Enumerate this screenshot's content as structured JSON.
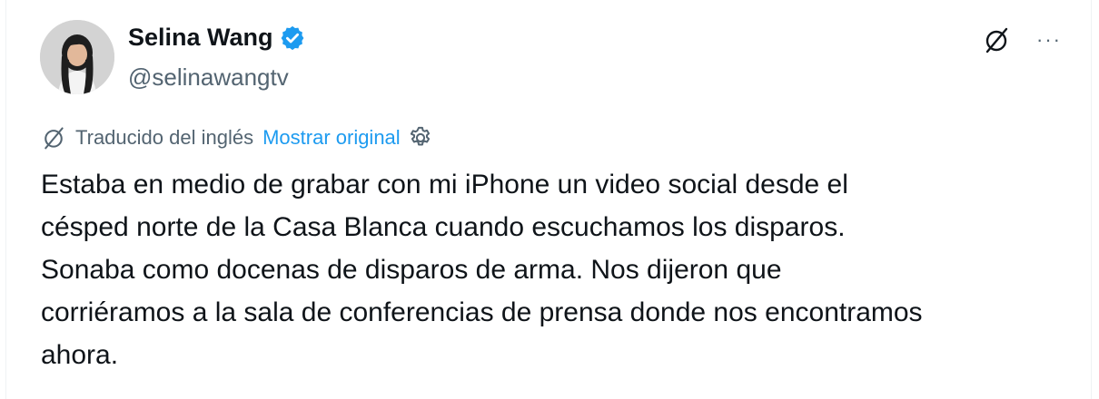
{
  "author": {
    "name": "Selina Wang",
    "handle": "@selinawangtv",
    "verified_color": "#1d9bf0"
  },
  "actions": {
    "translate_icon": "translate-icon",
    "more_label": "···"
  },
  "translation": {
    "label": "Traducido del inglés",
    "show_original": "Mostrar original",
    "settings_icon": "gear-icon"
  },
  "tweet": {
    "lines": [
      "Estaba en medio de grabar con mi iPhone un video social desde el",
      "césped norte de la Casa Blanca cuando escuchamos los disparos.",
      "Sonaba como docenas de disparos de arma. Nos dijeron que",
      "corriéramos a la sala de conferencias de prensa donde nos encontramos",
      "ahora."
    ]
  }
}
